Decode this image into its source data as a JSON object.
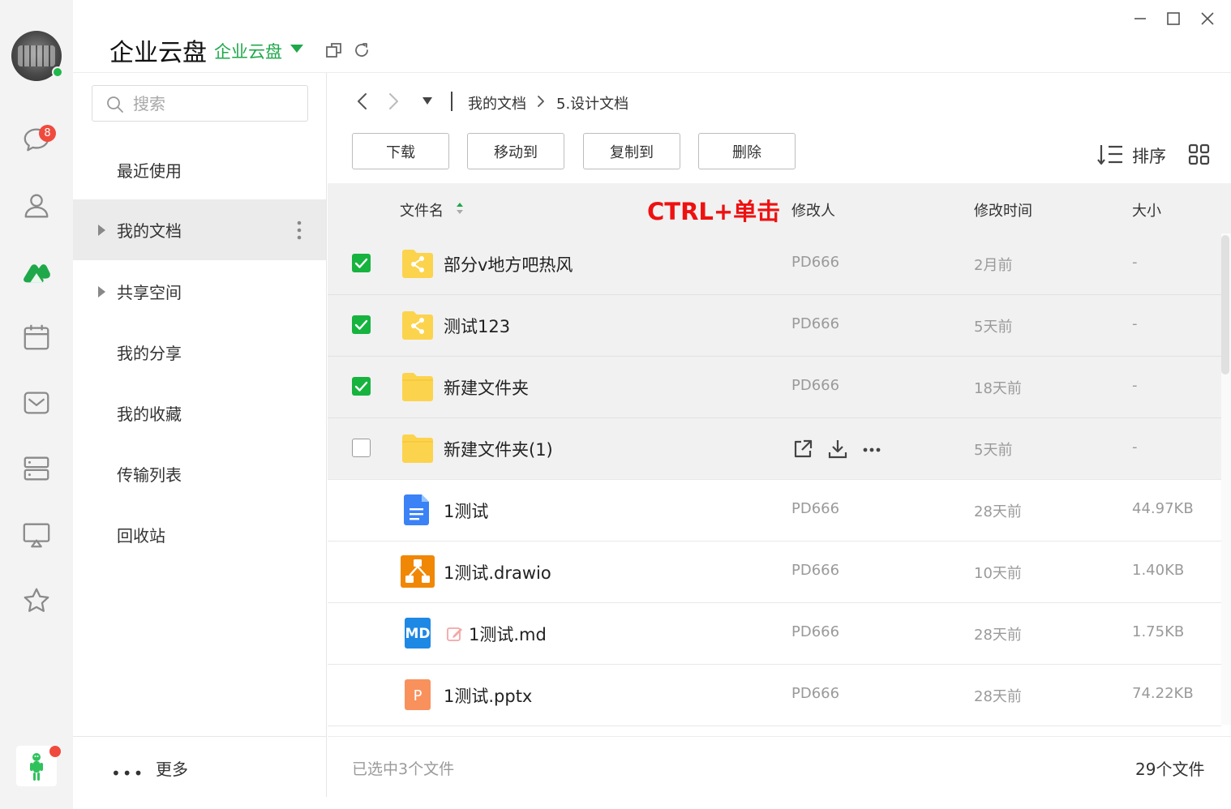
{
  "header": {
    "title": "企业云盘",
    "workspace": "企业云盘"
  },
  "rail": {
    "message_badge": "8"
  },
  "search": {
    "placeholder": "搜索"
  },
  "nav": {
    "items": [
      {
        "label": "最近使用"
      },
      {
        "label": "我的文档"
      },
      {
        "label": "共享空间"
      },
      {
        "label": "我的分享"
      },
      {
        "label": "我的收藏"
      },
      {
        "label": "传输列表"
      },
      {
        "label": "回收站"
      }
    ],
    "more_label": "更多"
  },
  "breadcrumb": {
    "items": [
      "我的文档",
      "5.设计文档"
    ]
  },
  "toolbar": {
    "download": "下载",
    "move_to": "移动到",
    "copy_to": "复制到",
    "delete": "删除",
    "sort": "排序"
  },
  "table": {
    "headers": {
      "name": "文件名",
      "modifier": "修改人",
      "modified": "修改时间",
      "size": "大小"
    },
    "annotation": "CTRL+单击",
    "rows": [
      {
        "name": "部分v地方吧热风",
        "modifier": "PD666",
        "modified": "2月前",
        "size": "-",
        "type": "shared-folder",
        "selected": true
      },
      {
        "name": "测试123",
        "modifier": "PD666",
        "modified": "5天前",
        "size": "-",
        "type": "shared-folder",
        "selected": true
      },
      {
        "name": "新建文件夹",
        "modifier": "PD666",
        "modified": "18天前",
        "size": "-",
        "type": "folder",
        "selected": true
      },
      {
        "name": "新建文件夹(1)",
        "modifier": "",
        "modified": "5天前",
        "size": "-",
        "type": "folder",
        "selected": false
      },
      {
        "name": "1测试",
        "modifier": "PD666",
        "modified": "28天前",
        "size": "44.97KB",
        "type": "doc"
      },
      {
        "name": "1测试.drawio",
        "modifier": "PD666",
        "modified": "10天前",
        "size": "1.40KB",
        "type": "drawio"
      },
      {
        "name": "1测试.md",
        "modifier": "PD666",
        "modified": "28天前",
        "size": "1.75KB",
        "type": "md"
      },
      {
        "name": "1测试.pptx",
        "modifier": "PD666",
        "modified": "28天前",
        "size": "74.22KB",
        "type": "pptx"
      }
    ]
  },
  "icons": {
    "md_label": "MD",
    "pptx_label": "P"
  },
  "status": {
    "selected": "已选中3个文件",
    "total": "29个文件"
  },
  "colors": {
    "accent": "#17b33f",
    "annotation": "#ee1111"
  }
}
